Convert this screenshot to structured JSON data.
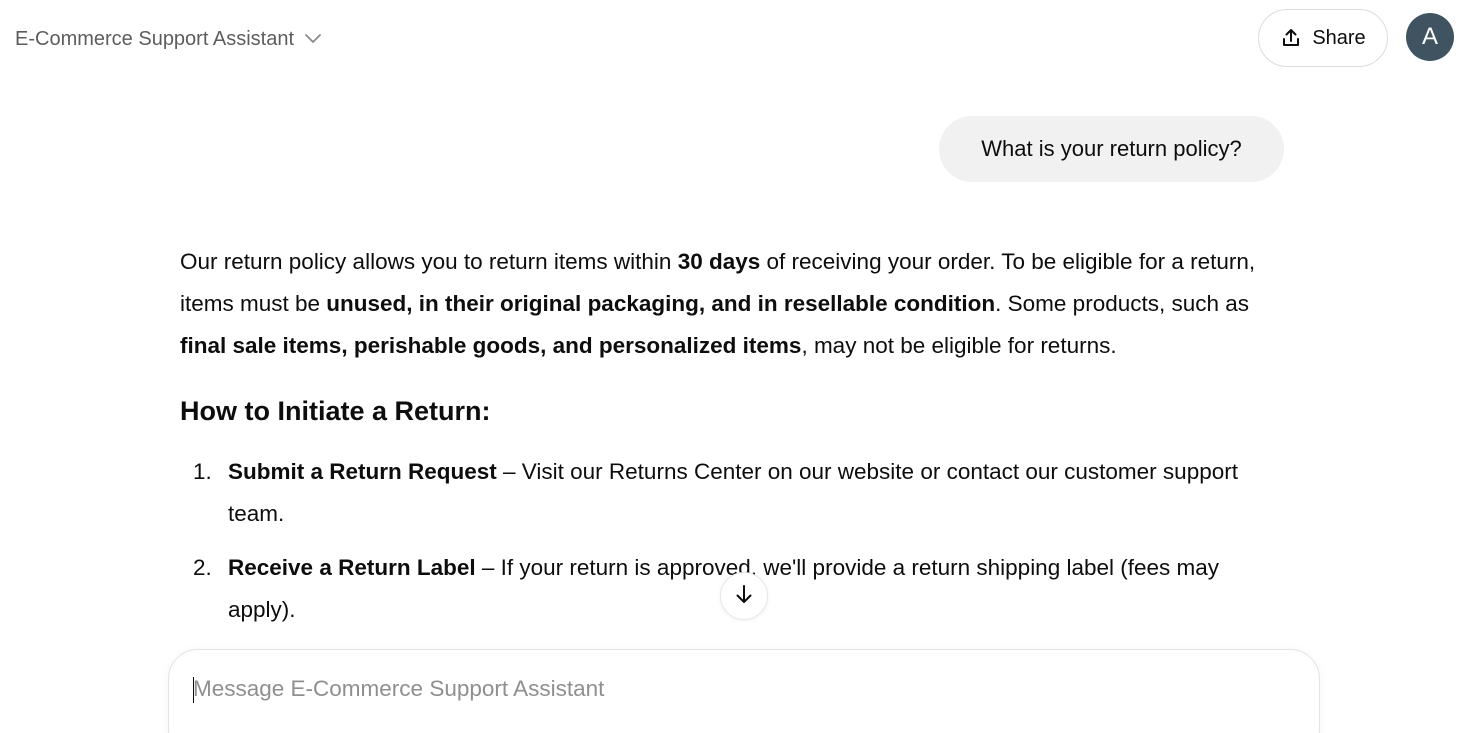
{
  "header": {
    "title": "E-Commerce Support Assistant",
    "share_label": "Share",
    "avatar_initial": "A"
  },
  "user_message": "What is your return policy?",
  "answer": {
    "p1": "Our return policy allows you to return items within ",
    "p1_bold": "30 days",
    "p2": " of receiving your order. To be eligible for a return, items must be ",
    "p2_bold": "unused, in their original packaging, and in resellable condition",
    "p3": ". Some products, such as ",
    "p3_bold": "final sale items, perishable goods, and personalized items",
    "p4": ", may not be eligible for returns.",
    "heading": "How to Initiate a Return:",
    "steps": [
      {
        "num": "1.",
        "title": "Submit a Return Request",
        "text": " – Visit our Returns Center on our website or contact our customer support team."
      },
      {
        "num": "2.",
        "title": "Receive a Return Label",
        "text": " – If your return is approved, we'll provide a return shipping label (fees may apply)."
      }
    ]
  },
  "composer": {
    "placeholder": "Message E-Commerce Support Assistant",
    "value": ""
  },
  "icons": {
    "title_dropdown": "chevron-down-icon",
    "share": "upload-icon",
    "scroll": "arrow-down-icon"
  }
}
